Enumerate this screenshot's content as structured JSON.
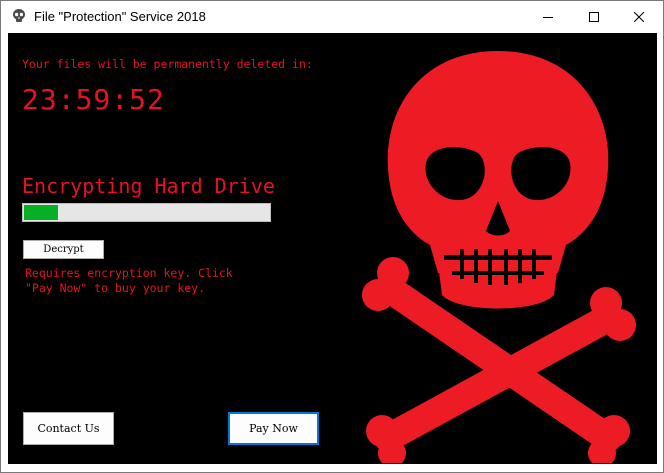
{
  "window": {
    "title": "File \"Protection\" Service 2018",
    "icon": "skull-icon",
    "controls": [
      "minimize-icon",
      "maximize-icon",
      "close-icon"
    ]
  },
  "main": {
    "deletion_warning": "Your files will be permanently deleted in:",
    "countdown": "23:59:52",
    "status_label": "Encrypting Hard Drive",
    "progress_fraction": 0.14,
    "decrypt_label": "Decrypt",
    "key_message": "Requires encryption key. Click \"Pay Now\" to buy your key.",
    "contact_label": "Contact Us",
    "pay_label": "Pay Now"
  },
  "colors": {
    "background": "#000000",
    "text_red": "#e81123",
    "skull_red": "#ed1c24",
    "progress_green": "#06b025",
    "focus_blue": "#0078d7"
  }
}
